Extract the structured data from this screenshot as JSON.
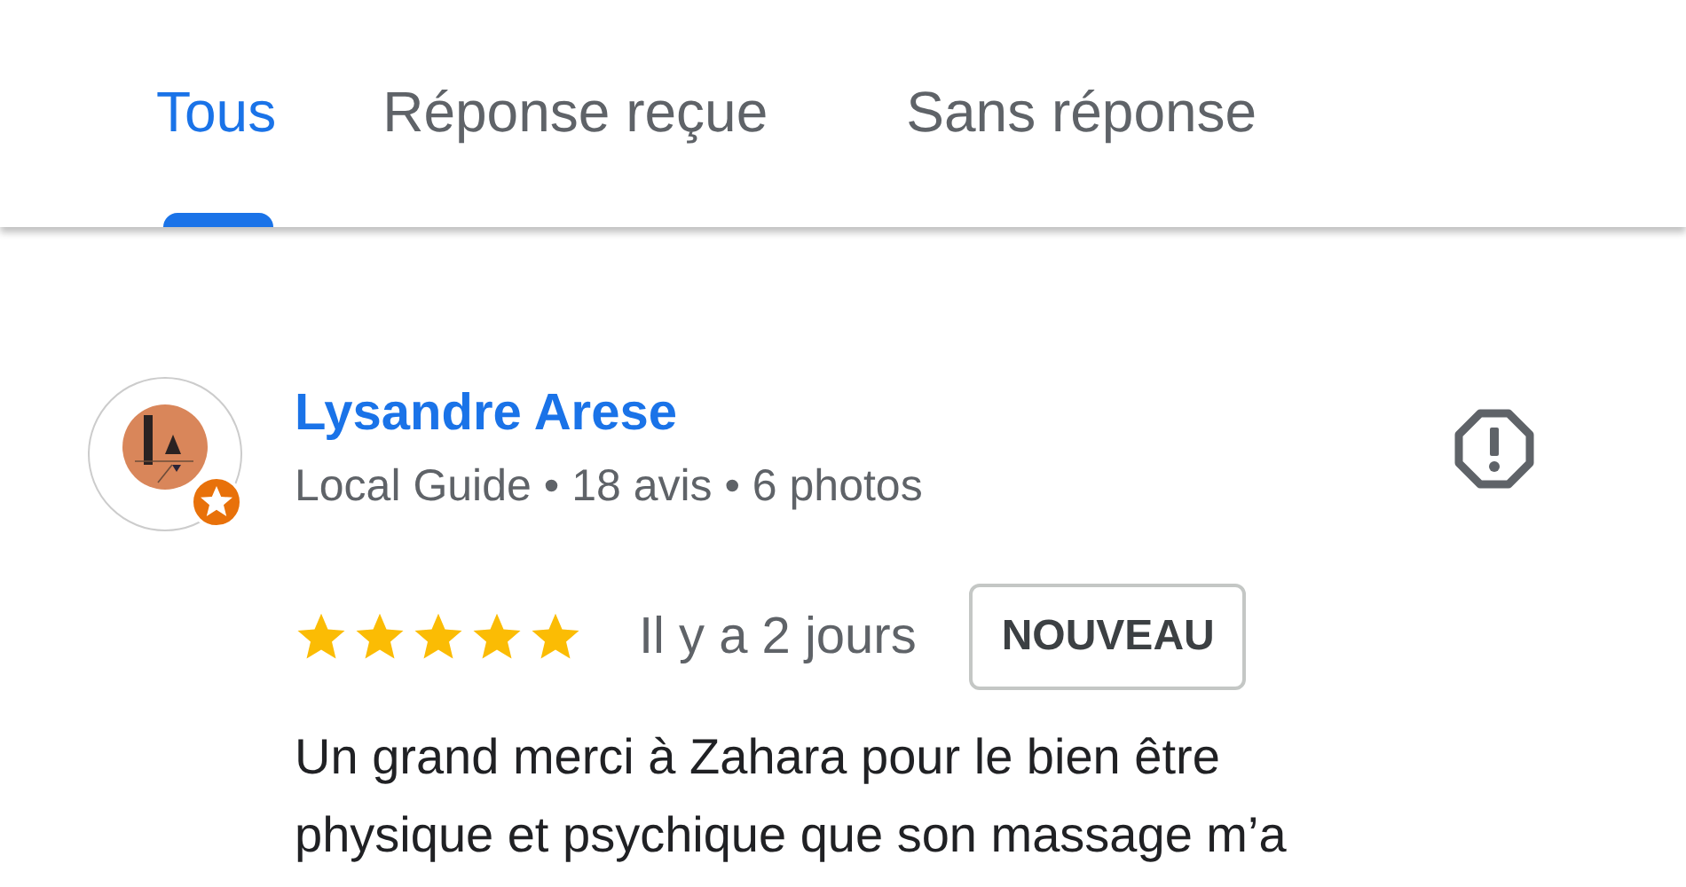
{
  "tabs": [
    {
      "label": "Tous",
      "selected": true
    },
    {
      "label": "Réponse reçue",
      "selected": false
    },
    {
      "label": "Sans réponse",
      "selected": false
    }
  ],
  "review": {
    "author": "Lysandre Arese",
    "meta": "Local Guide • 18 avis • 6 photos",
    "local_guide": true,
    "stars": 5,
    "time": "Il y a 2 jours",
    "badge": "NOUVEAU",
    "text": "Un grand merci à Zahara pour le bien être physique et psychique que son massage m’a"
  }
}
